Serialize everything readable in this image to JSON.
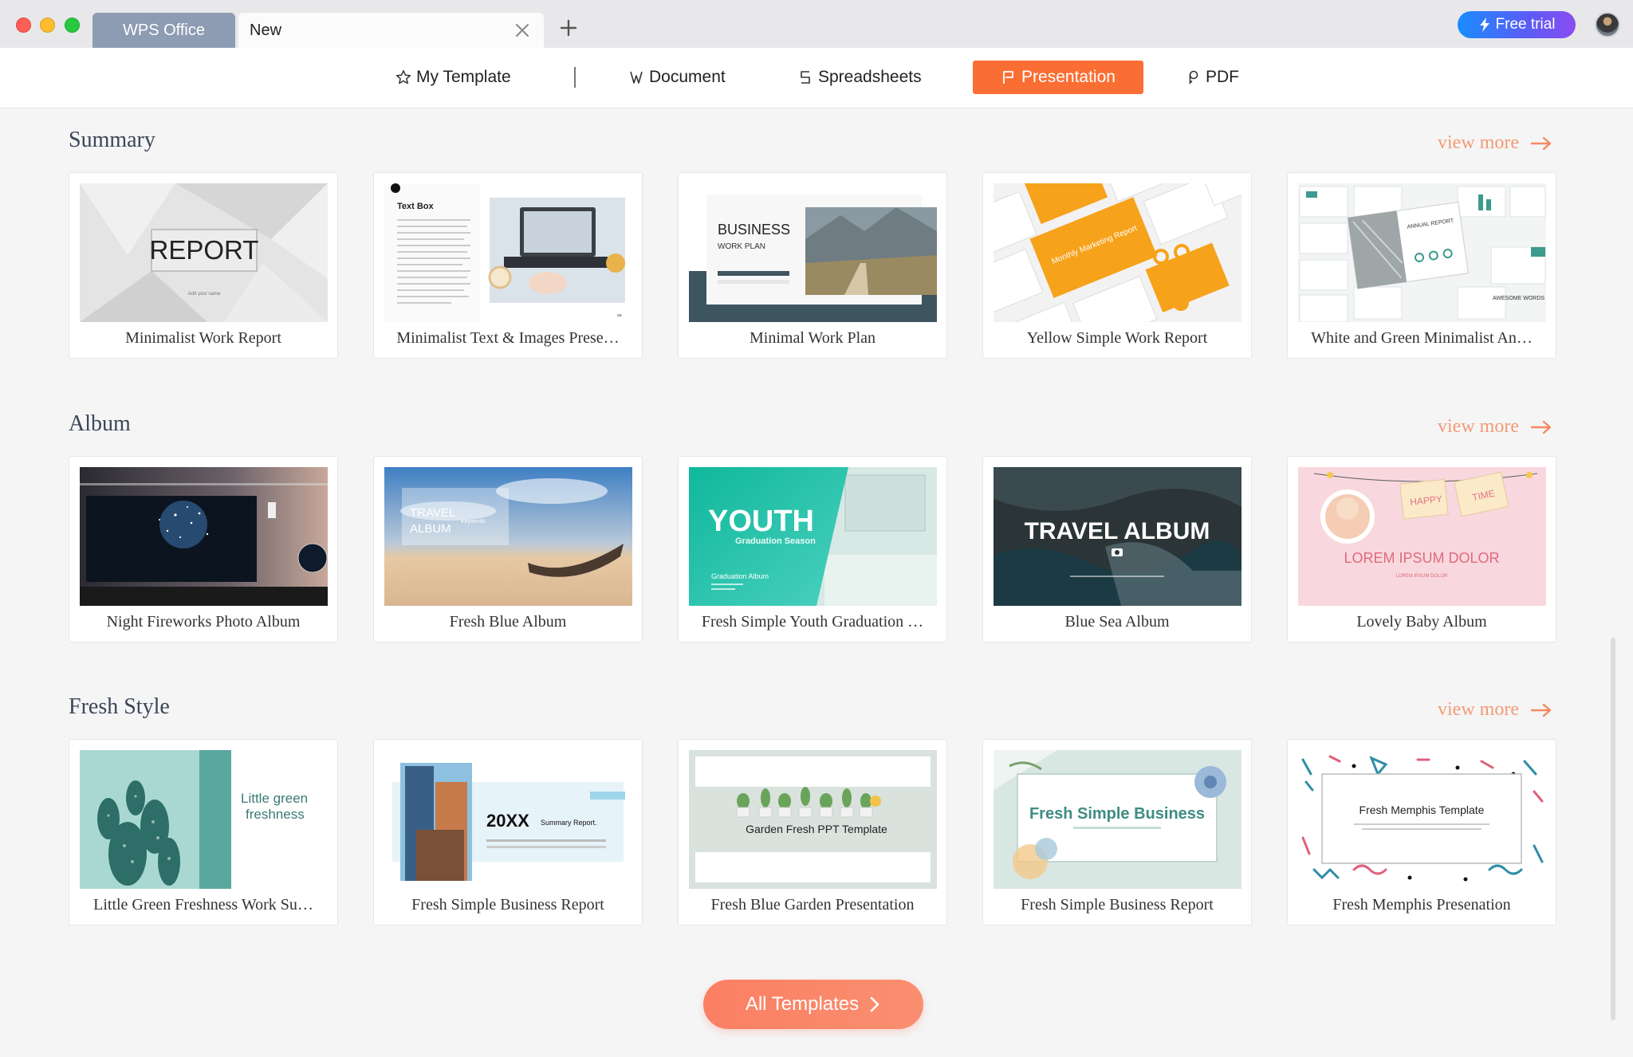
{
  "window": {
    "tabs": [
      "WPS Office",
      "New"
    ],
    "free_trial": "Free trial"
  },
  "nav": {
    "items": [
      {
        "label": "My Template",
        "icon": "star-icon"
      },
      {
        "label": "Document",
        "icon": "document-icon"
      },
      {
        "label": "Spreadsheets",
        "icon": "spreadsheet-icon"
      },
      {
        "label": "Presentation",
        "icon": "presentation-icon",
        "active": true
      },
      {
        "label": "PDF",
        "icon": "pdf-icon"
      }
    ],
    "active_color": "#fa6e33"
  },
  "view_more": "view more",
  "sections": [
    {
      "title": "Summary",
      "cards": [
        {
          "label": "Minimalist Work Report",
          "thumb_text": [
            "REPORT",
            "Add your name"
          ]
        },
        {
          "label": "Minimalist Text & Images Prese…",
          "thumb_text": [
            "Text Box"
          ]
        },
        {
          "label": "Minimal Work Plan",
          "thumb_text": [
            "BUSINESS",
            "WORK PLAN"
          ]
        },
        {
          "label": "Yellow Simple Work Report",
          "thumb_text": [
            "Monthly Marketing Report"
          ]
        },
        {
          "label": "White and Green Minimalist An…",
          "thumb_text": [
            "ANNUAL REPORT",
            "AWESOME WORDS"
          ]
        }
      ]
    },
    {
      "title": "Album",
      "cards": [
        {
          "label": "Night Fireworks Photo Album",
          "thumb_text": []
        },
        {
          "label": "Fresh Blue Album",
          "thumb_text": [
            "TRAVEL",
            "ALBUM",
            "Keywords"
          ]
        },
        {
          "label": "Fresh Simple Youth Graduation …",
          "thumb_text": [
            "YOUTH",
            "Graduation Season",
            "Graduation Album"
          ]
        },
        {
          "label": "Blue Sea Album",
          "thumb_text": [
            "TRAVEL ALBUM"
          ]
        },
        {
          "label": "Lovely Baby Album",
          "thumb_text": [
            "HAPPY",
            "TIME",
            "LOREM IPSUM DOLOR",
            "LOREM IPSUM DOLOR"
          ]
        }
      ]
    },
    {
      "title": "Fresh Style",
      "cards": [
        {
          "label": "Little Green Freshness Work Su…",
          "thumb_text": [
            "Little green",
            "freshness"
          ]
        },
        {
          "label": "Fresh Simple Business Report",
          "thumb_text": [
            "20XX",
            "Summary Report."
          ]
        },
        {
          "label": "Fresh Blue Garden Presentation",
          "thumb_text": [
            "Garden Fresh PPT Template"
          ]
        },
        {
          "label": "Fresh Simple Business Report",
          "thumb_text": [
            "Fresh Simple Business"
          ]
        },
        {
          "label": "Fresh Memphis Presenation",
          "thumb_text": [
            "Fresh Memphis Template"
          ]
        }
      ]
    }
  ],
  "all_templates": "All Templates"
}
